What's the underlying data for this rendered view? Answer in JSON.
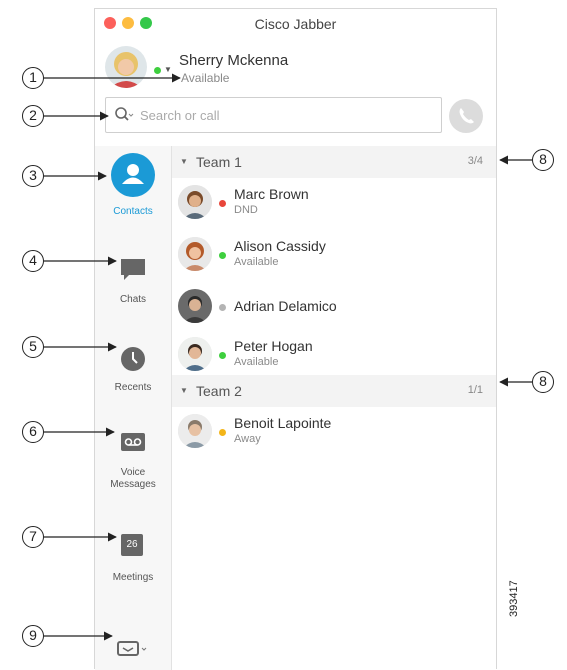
{
  "window": {
    "title": "Cisco Jabber"
  },
  "user": {
    "name": "Sherry Mckenna",
    "status": "Available"
  },
  "search": {
    "placeholder": "Search or call"
  },
  "sidebar": {
    "items": [
      {
        "label": "Contacts"
      },
      {
        "label": "Chats"
      },
      {
        "label": "Recents"
      },
      {
        "label": "Voice Messages"
      },
      {
        "label": "Meetings"
      }
    ],
    "calendar_day": "26"
  },
  "groups": [
    {
      "name": "Team 1",
      "count": "3/4",
      "contacts": [
        {
          "name": "Marc Brown",
          "status": "DND",
          "presence_color": "#e8463a"
        },
        {
          "name": "Alison Cassidy",
          "status": "Available",
          "presence_color": "#3ecf3e"
        },
        {
          "name": "Adrian Delamico",
          "status": "",
          "presence_color": "#b4b4b4"
        },
        {
          "name": "Peter Hogan",
          "status": "Available",
          "presence_color": "#3ecf3e"
        }
      ]
    },
    {
      "name": "Team 2",
      "count": "1/1",
      "contacts": [
        {
          "name": "Benoit Lapointe",
          "status": "Away",
          "presence_color": "#f3b519"
        }
      ]
    }
  ],
  "callouts": [
    "1",
    "2",
    "3",
    "4",
    "5",
    "6",
    "7",
    "8",
    "8",
    "9"
  ],
  "figure_number": "393417",
  "colors": {
    "accent": "#1b9ad6",
    "icon_gray": "#666666"
  }
}
